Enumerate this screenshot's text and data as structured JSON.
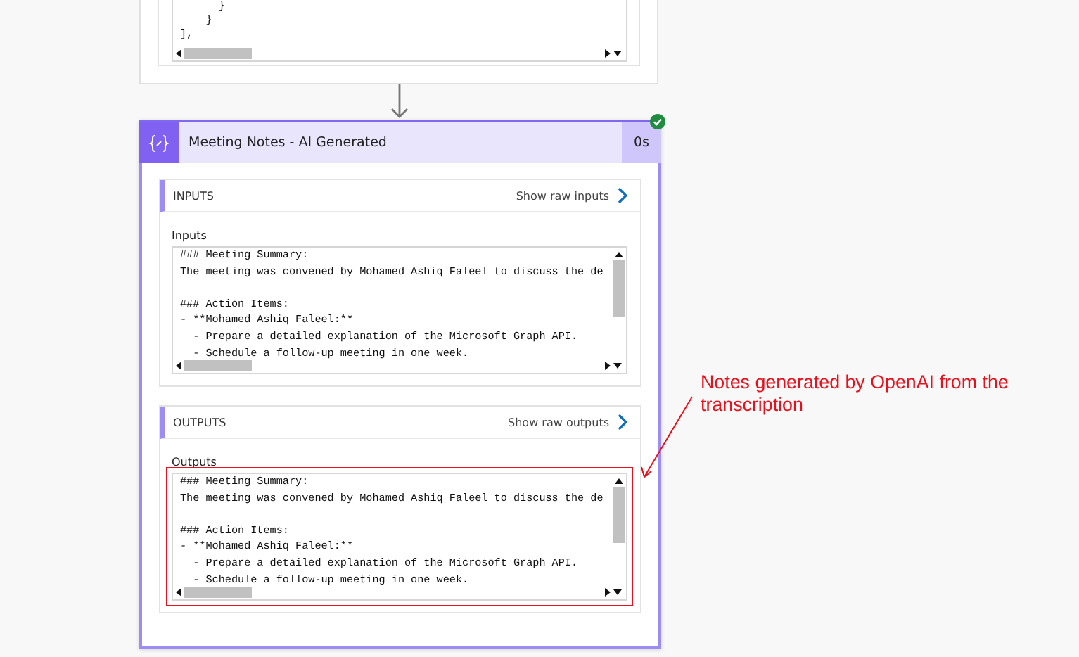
{
  "upstream_card": {
    "code_lines": [
      "      }",
      "    }",
      "],"
    ]
  },
  "action": {
    "title": "Meeting Notes - AI Generated",
    "duration": "0s",
    "succeeded": true,
    "sections": [
      {
        "heading": "INPUTS",
        "link": "Show raw inputs",
        "field_label": "Inputs",
        "highlighted": false,
        "paragraphs": [
          [
            "### Meeting Summary:",
            "The meeting was convened by Mohamed Ashiq Faleel to discuss the de"
          ],
          [
            "### Action Items:",
            "- **Mohamed Ashiq Faleel:**",
            "  - Prepare a detailed explanation of the Microsoft Graph API.",
            "  - Schedule a follow-up meeting in one week."
          ]
        ]
      },
      {
        "heading": "OUTPUTS",
        "link": "Show raw outputs",
        "field_label": "Outputs",
        "highlighted": true,
        "paragraphs": [
          [
            "### Meeting Summary:",
            "The meeting was convened by Mohamed Ashiq Faleel to discuss the de"
          ],
          [
            "### Action Items:",
            "- **Mohamed Ashiq Faleel:**",
            "  - Prepare a detailed explanation of the Microsoft Graph API.",
            "  - Schedule a follow-up meeting in one week."
          ]
        ]
      }
    ]
  },
  "annotation": {
    "text": "Notes generated by OpenAI from the transcription"
  }
}
